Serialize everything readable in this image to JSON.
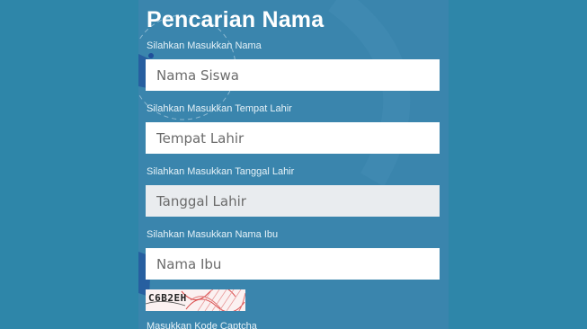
{
  "form": {
    "title": "Pencarian Nama",
    "fields": [
      {
        "label": "Silahkan Masukkan Nama",
        "placeholder": "Nama Siswa"
      },
      {
        "label": "Silahkan Masukkan Tempat Lahir",
        "placeholder": "Tempat Lahir"
      },
      {
        "label": "Silahkan Masukkan Tanggal Lahir",
        "placeholder": "Tanggal Lahir"
      },
      {
        "label": "Silahkan Masukkan Nama Ibu",
        "placeholder": "Nama Ibu"
      }
    ],
    "captcha": {
      "code": "C6B2EH",
      "label": "Masukkan Kode Captcha"
    }
  },
  "colors": {
    "page_background": "#2e86a9",
    "panel_background": "#3a85ad",
    "input_background": "#ffffff",
    "disabled_input_background": "#e9ecef"
  }
}
